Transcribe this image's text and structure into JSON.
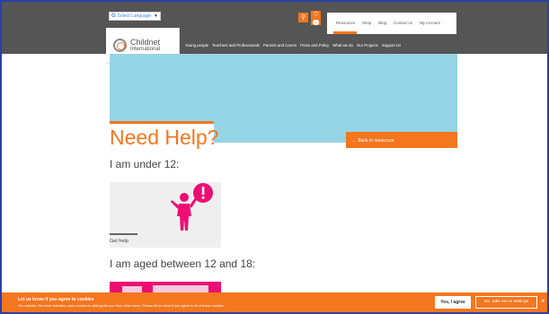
{
  "header": {
    "language_select": {
      "label": "Select Language",
      "icon": "google-g-icon"
    },
    "search_icon": "search-icon",
    "basket": {
      "icon": "basket-icon",
      "count": "0"
    },
    "utility_nav": [
      "Resources",
      "Shop",
      "Blog",
      "Contact us",
      "My Account"
    ],
    "logo": {
      "name": "Childnet",
      "sub": "International"
    },
    "main_nav": [
      "Young people",
      "Teachers and Professionals",
      "Parents and Carers",
      "Press and Policy",
      "What we do",
      "Our Projects",
      "Support Us"
    ]
  },
  "main": {
    "back_link": "← Back to resources",
    "title": "Need Help?",
    "section1": "I am under 12:",
    "card1_label": "Get help",
    "section2": "I am aged between 12 and 18:"
  },
  "cookie_banner": {
    "title": "Let us know if you agree to cookies",
    "text": "Our website, like most websites, uses cookies to distinguish you from other users. Please let us know if you agree to all of these cookies.",
    "yes_label": "Yes, I agree",
    "settings_label": "No, take me to settings",
    "close_label": "×"
  },
  "colors": {
    "accent": "#f4761f",
    "hero": "#95d4e4",
    "header": "#555555",
    "pink": "#ec0e73"
  }
}
